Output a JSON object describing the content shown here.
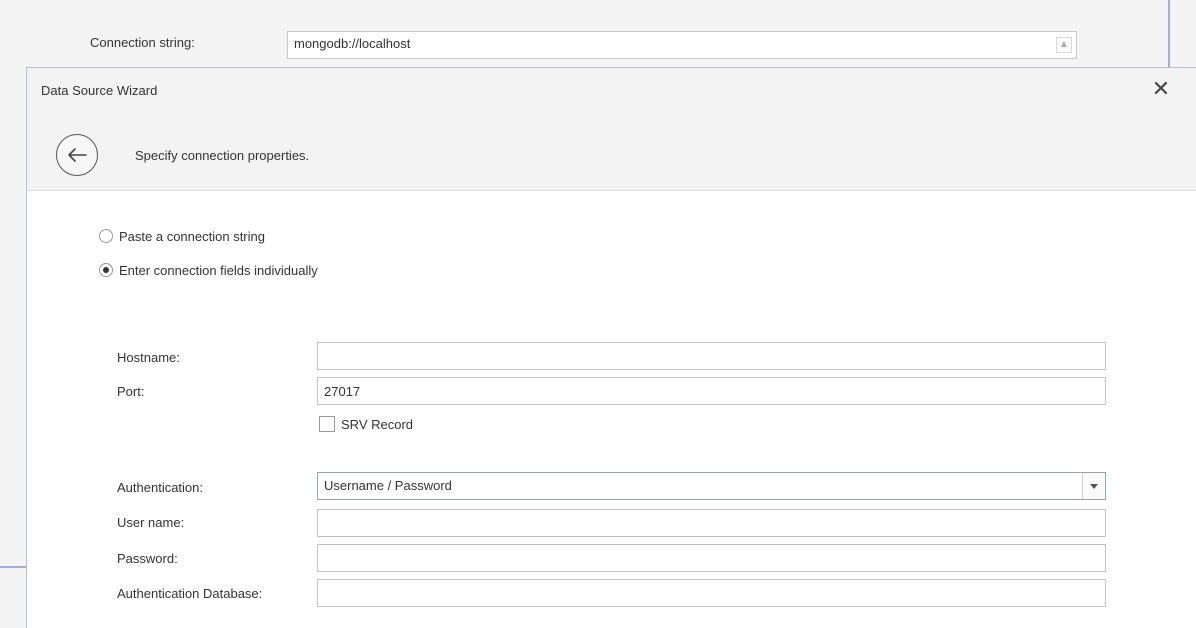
{
  "background": {
    "connection_label": "Connection string:",
    "connection_value": "mongodb://localhost"
  },
  "dialog": {
    "title": "Data Source Wizard",
    "header": "Specify connection properties.",
    "icons": {
      "back": "back-arrow-icon",
      "close": "close-icon"
    },
    "options": [
      {
        "label": "Paste a connection string",
        "checked": false
      },
      {
        "label": "Enter connection fields individually",
        "checked": true
      }
    ],
    "fields": {
      "hostname": {
        "label": "Hostname:",
        "value": ""
      },
      "port": {
        "label": "Port:",
        "value": "27017"
      },
      "srv_record": {
        "label": "SRV Record",
        "checked": false
      },
      "authentication": {
        "label": "Authentication:",
        "value": "Username / Password"
      },
      "user_name": {
        "label": "User name:",
        "value": ""
      },
      "password": {
        "label": "Password:",
        "value": ""
      },
      "auth_database": {
        "label": "Authentication Database:",
        "value": ""
      }
    }
  },
  "colors": {
    "dialog_border": "#b5c0d6",
    "background_window_border": "#9db0d8",
    "title_bar": "#f3f3f3"
  }
}
